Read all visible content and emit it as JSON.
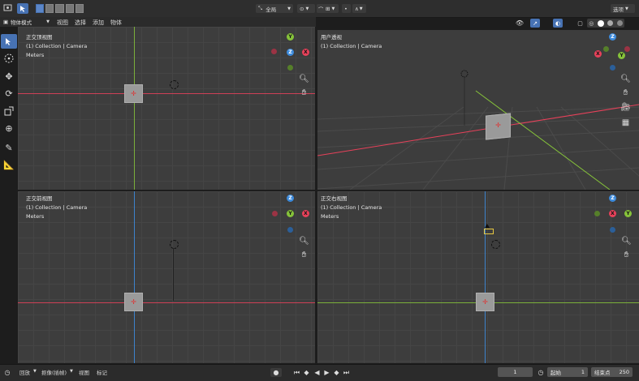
{
  "header": {
    "mode_label": "物体模式",
    "menu_view": "视图",
    "menu_select": "选择",
    "menu_add": "添加",
    "menu_object": "物体",
    "transform_orientation": "全局",
    "options_label": "选项"
  },
  "viewports": {
    "top": {
      "title": "正交顶视图",
      "collection": "(1) Collection | Camera",
      "units": "Meters"
    },
    "user": {
      "title": "用户透视",
      "collection": "(1) Collection | Camera",
      "units": "Meters"
    },
    "front": {
      "title": "正交前视图",
      "collection": "(1) Collection | Camera",
      "units": "Meters"
    },
    "right": {
      "title": "正交右视图",
      "collection": "(1) Collection | Camera",
      "units": "Meters"
    }
  },
  "gizmo": {
    "x": "X",
    "y": "Y",
    "z": "Z"
  },
  "colors": {
    "x_axis": "#e8415a",
    "y_axis": "#86c33a",
    "z_axis": "#3d8bdc",
    "accent": "#4772b3"
  },
  "icons": [
    "select-box-icon",
    "cursor-icon",
    "move-icon",
    "rotate-icon",
    "scale-icon",
    "transform-icon",
    "annotate-icon",
    "measure-icon",
    "zoom-icon",
    "hand-icon",
    "camera-icon",
    "grid-icon"
  ],
  "timeline": {
    "playback": "回放",
    "keying": "抠像(插帧)",
    "view": "视图",
    "marker": "标记",
    "current_frame": "1",
    "start_label": "起始",
    "start_value": "1",
    "end_label": "结束点",
    "end_value": "250"
  }
}
